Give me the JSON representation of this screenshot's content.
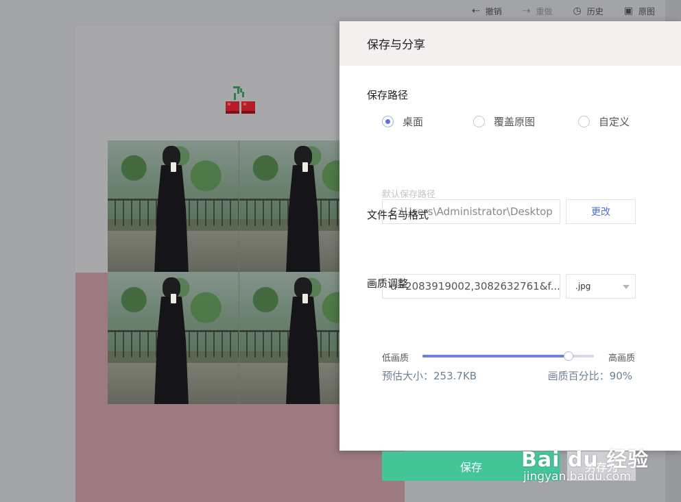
{
  "toolbar": {
    "undo": "撤销",
    "redo": "重做",
    "history": "历史",
    "original": "原图"
  },
  "dialog": {
    "title": "保存与分享",
    "save_path": {
      "title": "保存路径",
      "options": [
        "桌面",
        "覆盖原图",
        "自定义"
      ],
      "selected": "桌面",
      "hint": "默认保存路径",
      "path_value": "C:\\Users\\Administrator\\Desktop",
      "change_label": "更改"
    },
    "filename": {
      "title": "文件名与格式",
      "name_value": "u=2083919002,3082632761&f...",
      "format_value": ".jpg"
    },
    "quality": {
      "title": "画质调整",
      "low_label": "低画质",
      "high_label": "高画质",
      "level": 0.85,
      "size_estimate": "预估大小：253.7KB",
      "percent_text": "画质百分比：90%"
    },
    "buttons": {
      "save": "保存",
      "save_as": "另存为"
    }
  },
  "watermark": {
    "brand": "Bai du 经验",
    "url": "jingyan.baidu.com"
  },
  "colors": {
    "accent_green": "#44c597",
    "accent_blue": "#5b73d8",
    "dialog_header": "#f3efee"
  }
}
